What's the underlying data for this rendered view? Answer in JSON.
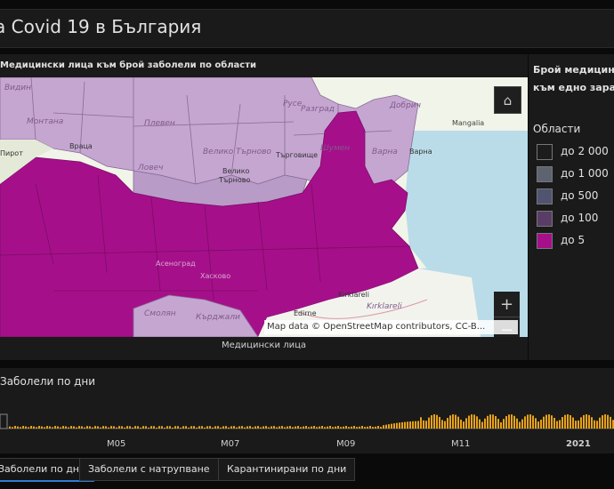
{
  "header": {
    "title": "a Covid 19 в България"
  },
  "map": {
    "title": "Медицински лица към брой заболели по области",
    "footer": "Медицински лица",
    "attribution": "Map data © OpenStreetMap contributors, CC-B...",
    "home_icon": "home-icon",
    "zoom_in_label": "+",
    "zoom_out_label": "−",
    "labels": {
      "vidin": "Видин",
      "montana": "Монтана",
      "pleven": "Плевен",
      "ruse": "Русе",
      "razgrad": "Разград",
      "dobrich": "Добрич",
      "mangalia": "Mangalia",
      "vratsa": "Враца",
      "lovech": "Ловеч",
      "veliko_tarnovo": "Велико Търново",
      "targovishte": "Търговище",
      "shumen": "Шумен",
      "varna_region": "Варна",
      "varna_city": "Варна",
      "veliko_city": "Велико",
      "tarnovo_city": "Търново",
      "pirot": "Пирот",
      "haskovo": "Хасково",
      "smolyan": "Смолян",
      "kardzhali": "Кърджали",
      "kirklareli_city": "Kırklareli",
      "kirklareli_region": "Kırklareli",
      "edirne": "Edirne",
      "asenovgrad": "Асеноград",
      "razgrad_city": "Разград",
      "pleven_city": "Плевен"
    }
  },
  "legend": {
    "title": "Брой медицински лица към едно заразено лице",
    "subtitle": "Области",
    "items": [
      {
        "label": "до 2 000",
        "color": "#1c1c1c"
      },
      {
        "label": "до 1 000",
        "color": "#5d6470"
      },
      {
        "label": "до 500",
        "color": "#505470"
      },
      {
        "label": "до 100",
        "color": "#5a3d66"
      },
      {
        "label": "до 5",
        "color": "#a5108a"
      }
    ]
  },
  "chart": {
    "title": "Заболели по дни",
    "months": [
      "M05",
      "M07",
      "M09",
      "M11",
      "2021"
    ],
    "bar_color": "#e8a21a"
  },
  "tabs": [
    {
      "label": "Заболели по дни",
      "active": true
    },
    {
      "label": "Заболели с натрупване",
      "active": false
    },
    {
      "label": "Карантинирани по дни",
      "active": false
    }
  ],
  "colors": {
    "high": "#a5108a",
    "light": "#c5a6d1",
    "mid": "#b89bc7",
    "sea": "#b9dce8",
    "land": "#f1f4e8"
  }
}
